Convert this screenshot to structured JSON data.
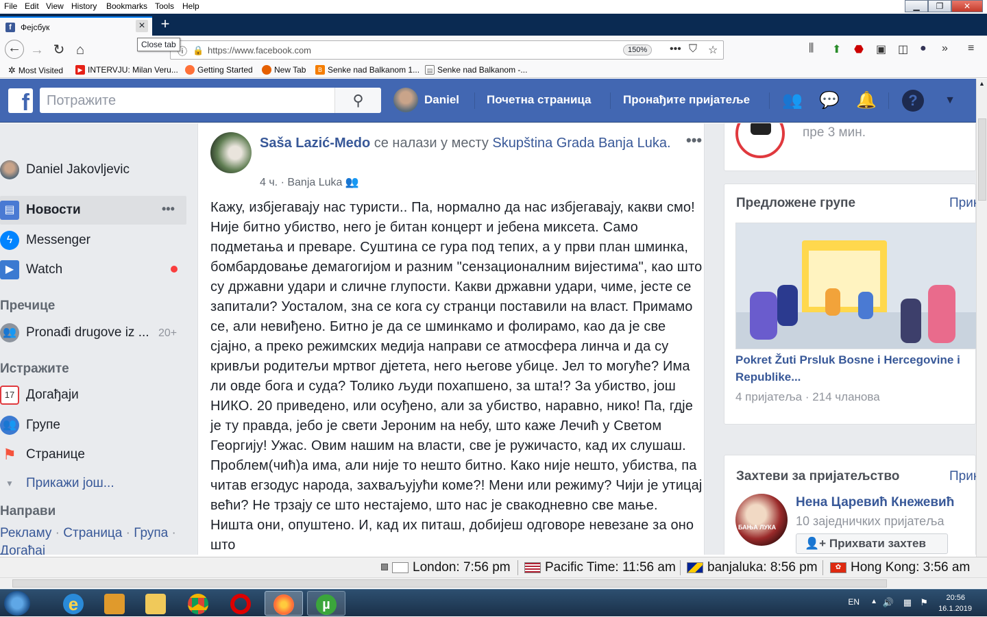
{
  "menu": [
    "File",
    "Edit",
    "View",
    "History",
    "Bookmarks",
    "Tools",
    "Help"
  ],
  "browser": {
    "tab_title": "Фејсбук",
    "close_tab_tooltip": "Close tab",
    "url": "https://www.facebook.com",
    "zoom": "150%"
  },
  "bookmarks": [
    {
      "label": "Most Visited",
      "icon": "gear-icon",
      "color": "#555"
    },
    {
      "label": "INTERVJU: Milan Veru...",
      "icon": "youtube-icon",
      "color": "#e62117"
    },
    {
      "label": "Getting Started",
      "icon": "firefox-icon",
      "color": "#ff7139"
    },
    {
      "label": "New Tab",
      "icon": "firefox-icon",
      "color": "#e66000"
    },
    {
      "label": "Senke nad Balkanom 1...",
      "icon": "blogger-icon",
      "color": "#f57d00"
    },
    {
      "label": "Senke nad Balkanom -...",
      "icon": "page-icon",
      "color": "#777"
    }
  ],
  "fb": {
    "search_placeholder": "Потражите",
    "user_name": "Daniel",
    "home": "Почетна страница",
    "find_friends": "Пронађите пријатеље",
    "colors": {
      "brand": "#4267b2",
      "link": "#385898"
    }
  },
  "left": {
    "profile": "Daniel Jakovljevic",
    "news": "Новости",
    "messenger": "Messenger",
    "watch": "Watch",
    "shortcuts_head": "Пречице",
    "shortcut1": "Pronađi drugove iz ...",
    "shortcut1_count": "20+",
    "explore_head": "Истражите",
    "events": "Догађаји",
    "events_date": "17",
    "groups": "Групе",
    "pages": "Странице",
    "more": "Прикажи још...",
    "create_head": "Направи",
    "create_ad": "Рекламу",
    "create_page": "Страница",
    "create_group": "Група",
    "create_event": "Догађај",
    "sep": " · "
  },
  "post": {
    "author": "Saša Lazić-Medo",
    "at_text": " се налази у месту ",
    "place": "Skupština Grada Banja Luka",
    "dot": ".",
    "time": "4 ч.",
    "meta_sep": " · ",
    "location": "Banja Luka",
    "body": "Кажу, избјегавају нас туристи.. Па, нормално да нас избјегавају, какви смо! Није битно убиство, него је битан концерт и јебена миксета. Само подметања и преваре. Суштина се гура под тепих, а у први план шминка, бомбардовање демагогијом и разним \"сензационалним вијестима\", као што су државни удари и сличне глупости. Какви државни удари, чиме, јесте се запитали? Уосталом, зна се кога су странци поставили на власт. Примамо се, али невиђено. Битно је да се шминкамо и фолирамо, као да је све сјајно, а преко режимских медија направи се атмосфера линча и да су кривљи родитељи мртвог дјетета, него његове убице. Јел то могуће? Има ли овде бога и суда? Толико људи похапшено, за шта!? За убиство, још НИКО. 20 приведено, или осуђено, али за убиство, наравно, нико! Па, гдје је ту правда, јебо је свети Јероним на небу, што каже Лечић у Светом Георгију! Ужас. Овим нашим на власти, све је ружичасто, кад их слушаш. Проблем(чић)а има, али није то нешто битно. Како није нешто, убиства, па читав егзодус народа, захваљујући коме?! Мени или режиму? Чији је утицај већи? Не трзају се што нестајемо, што нас је свакодневно све мање. Ништа они, опуштено. И, кад их питаш, добијеш одговоре невезане за оно што"
  },
  "right": {
    "top_time": "пре 3 мин.",
    "groups_title": "Предложене групе",
    "see_all": "Прик",
    "group_name": "Pokret Žuti Prsluk Bosne i Hercegovine i Republike...",
    "group_meta": "4 пријатеља · 214 чланова",
    "requests_title": "Захтеви за пријатељство",
    "request_name": "Нена Царевић Кнежевић",
    "request_mutual": "10 заједничких пријатеља",
    "accept": "Прихвати захтев",
    "avatar_caption": "БАЊА ЛУКА"
  },
  "clocks": [
    {
      "label": "London: 7:56 pm",
      "flag": "uk"
    },
    {
      "label": "Pacific Time: 11:56 am",
      "flag": "us"
    },
    {
      "label": "banjaluka: 8:56 pm",
      "flag": "ba"
    },
    {
      "label": "Hong Kong: 3:56 am",
      "flag": "hk"
    }
  ],
  "tray": {
    "lang": "EN",
    "time": "20:56",
    "date": "16.1.2019"
  }
}
